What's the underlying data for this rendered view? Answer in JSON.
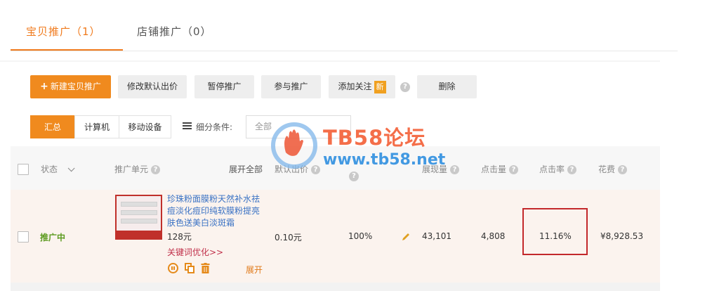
{
  "tabs": [
    {
      "label": "宝贝推广（1）",
      "active": true
    },
    {
      "label": "店铺推广（0）",
      "active": false
    }
  ],
  "toolbar": {
    "new_promo_label": "新建宝贝推广",
    "edit_bid_label": "修改默认出价",
    "pause_label": "暂停推广",
    "join_label": "参与推广",
    "follow_label": "添加关注",
    "follow_badge": "新",
    "delete_label": "删除",
    "help_glyph": "?"
  },
  "filters": {
    "segments": [
      "汇总",
      "计算机",
      "移动设备"
    ],
    "active_segment": "汇总",
    "condition_label": "细分条件:",
    "condition_value": "全部"
  },
  "table": {
    "headers": {
      "status": "状态",
      "unit": "推广单元",
      "expand_all": "展开全部",
      "default_bid": "默认出价",
      "impressions": "展现量",
      "clicks": "点击量",
      "ctr": "点击率",
      "cost": "花费"
    },
    "row": {
      "status": "推广中",
      "title": "珍珠粉面膜粉天然补水祛痘淡化痘印纯软膜粉提亮肤色送美白淡斑霜",
      "price": "128元",
      "keyword_link": "关键词优化>>",
      "expand": "展开",
      "bid": "0.10元",
      "ratio": "100%",
      "impressions": "43,101",
      "clicks": "4,808",
      "ctr": "11.16%",
      "cost": "¥8,928.53"
    }
  },
  "watermark": {
    "title": "TB58论坛",
    "url": "www.tb58.net"
  },
  "colors": {
    "accent": "#f08a1e",
    "status_green": "#5b9a1e",
    "link_blue": "#3a72c4",
    "highlight_red": "#c3282b"
  }
}
